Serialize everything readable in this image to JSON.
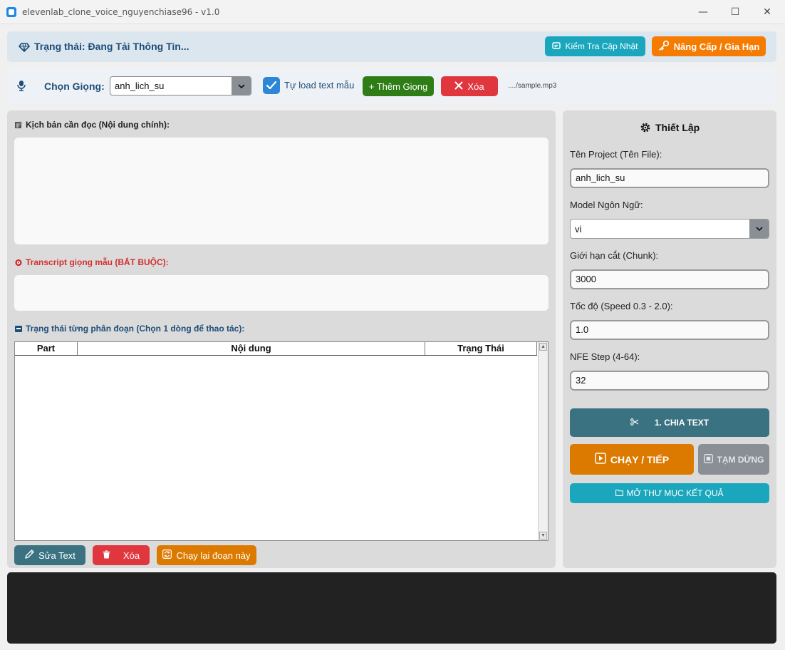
{
  "window": {
    "title": "elevenlab_clone_voice_nguyenchiase96 - v1.0",
    "minimize": "—",
    "maximize": "☐",
    "close": "✕"
  },
  "status": {
    "text": "Trạng thái: Đang Tải Thông Tin...",
    "check_update": "Kiểm Tra Cập Nhật",
    "upgrade": "Nâng Cấp / Gia Hạn"
  },
  "voice": {
    "label": "Chọn Giọng:",
    "selected": "anh_lich_su",
    "auto_load_label": "Tự load text mẫu",
    "auto_load_checked": true,
    "add_voice": "+ Thêm Giọng",
    "delete": "Xóa",
    "sample_path": "..../sample.mp3"
  },
  "editor": {
    "script_label": "Kịch bản cần đọc (Nội dung chính):",
    "script_value": "",
    "transcript_label": "Transcript giọng mẫu (BẮT BUỘC):",
    "transcript_value": "",
    "segments_label": "Trạng thái từng phân đoạn (Chọn 1 dòng để thao tác):",
    "columns": [
      "Part",
      "Nội dung",
      "Trạng Thái"
    ],
    "rows": [],
    "edit_text": "Sửa Text",
    "delete": "Xóa",
    "rerun": "Chạy lại đoạn này"
  },
  "settings": {
    "title": "Thiết Lập",
    "project_label": "Tên Project (Tên File):",
    "project_value": "anh_lich_su",
    "model_label": "Model Ngôn Ngữ:",
    "model_value": "vi",
    "chunk_label": "Giới hạn cắt (Chunk):",
    "chunk_value": "3000",
    "speed_label": "Tốc độ (Speed 0.3 - 2.0):",
    "speed_value": "1.0",
    "nfe_label": "NFE Step (4-64):",
    "nfe_value": "32",
    "split_text": "1. CHIA TEXT",
    "run": "CHẠY / TIẾP",
    "pause": "TẠM DỪNG",
    "open_folder": "MỞ THƯ MỤC KẾT QUẢ"
  },
  "colors": {
    "status_text": "#1f4e79",
    "teal": "#3a7282",
    "orange": "#f57c00",
    "green": "#2e7d16",
    "red": "#e0363e",
    "run_orange": "#dc7a00",
    "gray": "#8a8f96",
    "cyan": "#1aa7bd",
    "console": "#222222"
  }
}
